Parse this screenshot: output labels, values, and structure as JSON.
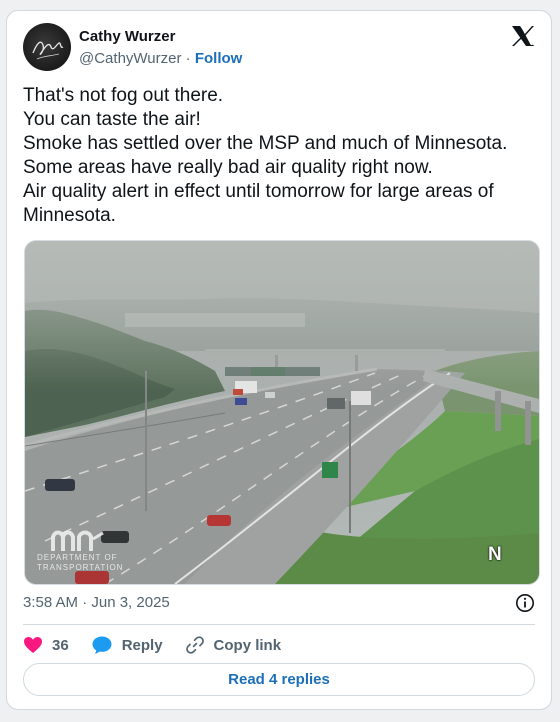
{
  "author": {
    "name": "Cathy Wurzer",
    "handle": "@CathyWurzer",
    "separator": "·",
    "follow_label": "Follow"
  },
  "tweet": {
    "lines": [
      "That's not fog out there.",
      "You can taste the air!",
      "Smoke has settled over the MSP and much of Minnesota.",
      "Some areas have really bad air quality right now.",
      "Air quality alert in effect until tomorrow for large areas of",
      "Minnesota."
    ],
    "timestamp": "3:58 AM · Jun 3, 2025"
  },
  "media": {
    "watermark_line1": "DEPARTMENT OF",
    "watermark_line2": "TRANSPORTATION",
    "compass": "N"
  },
  "actions": {
    "likes": "36",
    "reply_label": "Reply",
    "copy_label": "Copy link"
  },
  "read_replies_label": "Read 4 replies",
  "icons": [
    "x-logo-icon",
    "heart-icon",
    "reply-icon",
    "link-icon",
    "info-icon"
  ],
  "colors": {
    "accent": "#1d6fb8",
    "heart": "#f91880",
    "reply": "#1d9bf0"
  }
}
